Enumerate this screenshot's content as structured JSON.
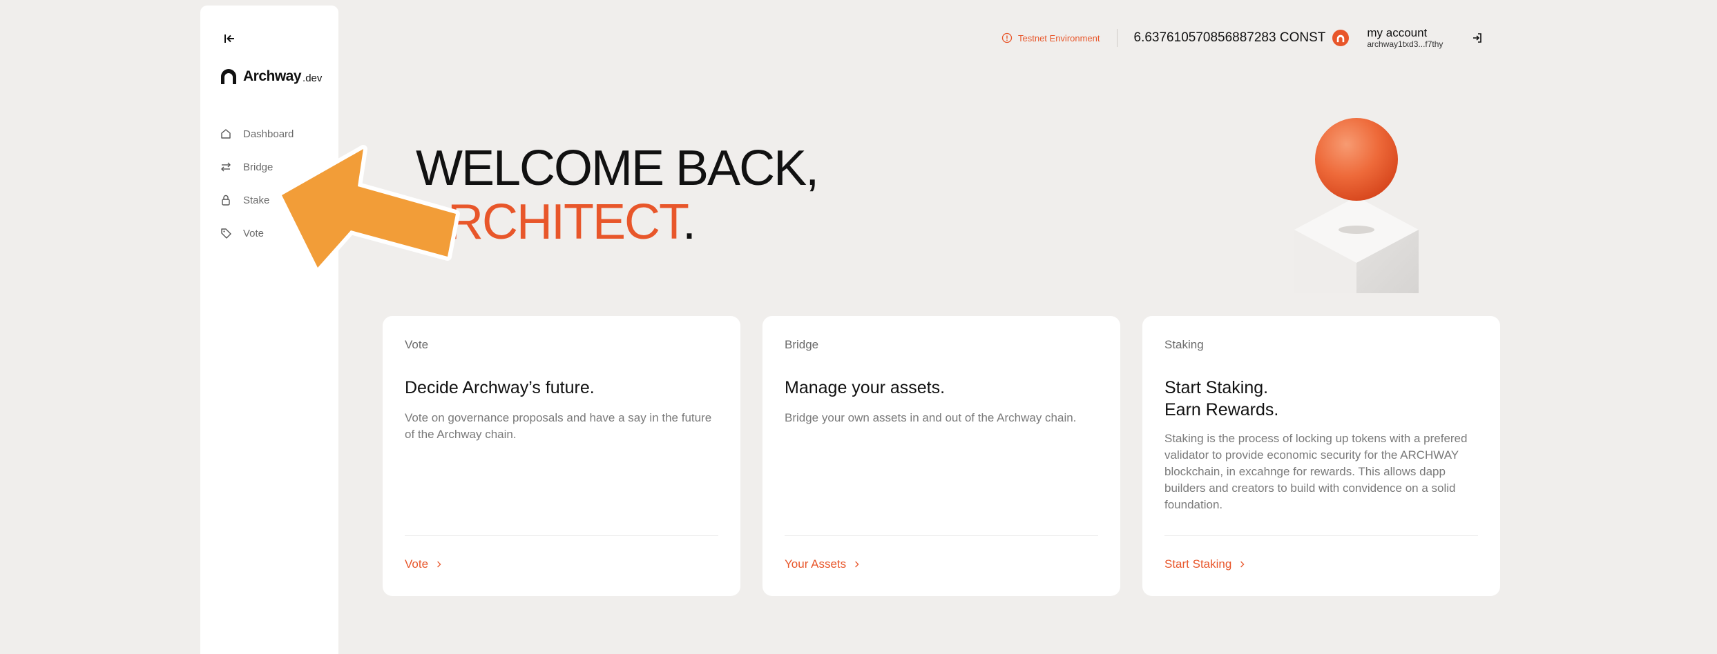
{
  "brand": {
    "name": "Archway",
    "suffix": ".dev"
  },
  "sidebar": {
    "items": [
      {
        "label": "Dashboard",
        "icon": "home-icon"
      },
      {
        "label": "Bridge",
        "icon": "arrows-swap-icon"
      },
      {
        "label": "Stake",
        "icon": "lock-icon"
      },
      {
        "label": "Vote",
        "icon": "tag-icon"
      }
    ]
  },
  "header": {
    "env_label": "Testnet Environment",
    "balance": "6.637610570856887283 CONST",
    "account_label": "my account",
    "account_address": "archway1txd3...f7thy"
  },
  "hero": {
    "line1": "WELCOME BACK,",
    "line2": "ARCHITECT",
    "line2_suffix": "."
  },
  "cards": [
    {
      "eyebrow": "Vote",
      "title": "Decide Archway’s future.",
      "description": "Vote on governance proposals and have a say in the future of the Archway chain.",
      "link": "Vote"
    },
    {
      "eyebrow": "Bridge",
      "title": "Manage your assets.",
      "description": "Bridge your own assets in and out of the Archway chain.",
      "link": "Your Assets"
    },
    {
      "eyebrow": "Staking",
      "title_line1": "Start Staking.",
      "title_line2": "Earn Rewards.",
      "description": "Staking is the process of locking up tokens with a prefered validator to provide economic security for the ARCHWAY blockchain, in excahnge for rewards. This allows dapp builders and creators to build with convidence on a solid foundation.",
      "link": "Start Staking"
    }
  ],
  "colors": {
    "accent": "#e8562a",
    "background": "#f0eeec",
    "card": "#ffffff",
    "annotation_arrow": "#f29d38"
  }
}
